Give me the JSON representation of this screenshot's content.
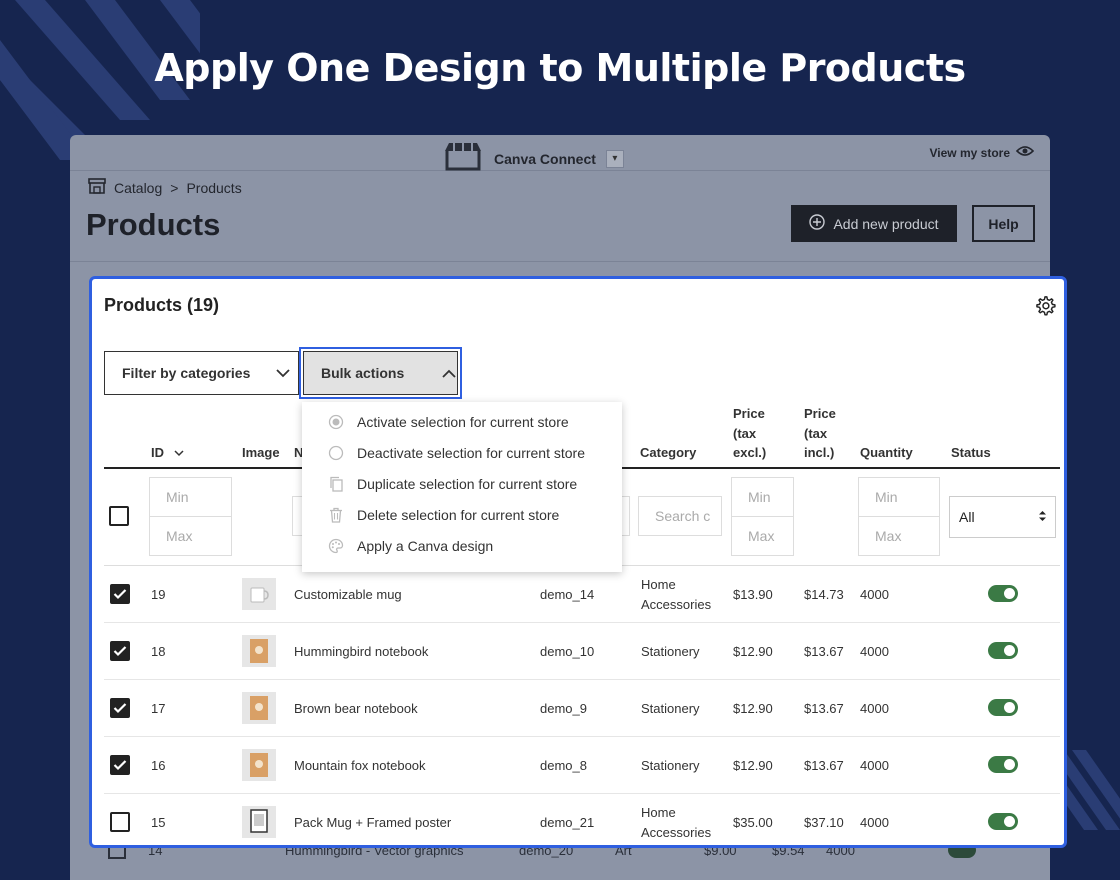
{
  "banner": {
    "title": "Apply One Design to Multiple Products"
  },
  "store": {
    "brand_name": "Canva Connect",
    "view_store": "View my store",
    "breadcrumb": [
      "Catalog",
      ">",
      "Products"
    ],
    "page_title": "Products",
    "add_product": "Add new product",
    "help": "Help",
    "ghost_row": {
      "id": "14",
      "name": "Hummingbird - Vector graphics",
      "reference": "demo_20",
      "category": "Art",
      "price_excl": "$9.00",
      "price_incl": "$9.54",
      "quantity": "4000"
    }
  },
  "card": {
    "title": "Products (19)",
    "filter_label": "Filter by categories",
    "bulk_label": "Bulk actions",
    "headers": {
      "id": "ID",
      "image": "Image",
      "name": "N",
      "category": "Category",
      "price_excl": [
        "Price",
        "(tax",
        "excl.)"
      ],
      "price_incl": [
        "Price",
        "(tax",
        "incl.)"
      ],
      "quantity": "Quantity",
      "status": "Status"
    },
    "filters": {
      "min": "Min",
      "max": "Max",
      "search": "Search c",
      "status_value": "All"
    },
    "bulk_menu": [
      {
        "label": "Activate selection for current store",
        "icon": "radio-filled-icon"
      },
      {
        "label": "Deactivate selection for current store",
        "icon": "radio-empty-icon"
      },
      {
        "label": "Duplicate selection for current store",
        "icon": "copy-icon"
      },
      {
        "label": "Delete selection for current store",
        "icon": "trash-icon"
      },
      {
        "label": "Apply a Canva design",
        "icon": "palette-icon"
      }
    ],
    "rows": [
      {
        "checked": true,
        "id": "19",
        "name": "Customizable mug",
        "reference": "demo_14",
        "category": [
          "Home",
          "Accessories"
        ],
        "price_excl": "$13.90",
        "price_incl": "$14.73",
        "quantity": "4000",
        "active": true
      },
      {
        "checked": true,
        "id": "18",
        "name": "Hummingbird notebook",
        "reference": "demo_10",
        "category": [
          "Stationery"
        ],
        "price_excl": "$12.90",
        "price_incl": "$13.67",
        "quantity": "4000",
        "active": true
      },
      {
        "checked": true,
        "id": "17",
        "name": "Brown bear notebook",
        "reference": "demo_9",
        "category": [
          "Stationery"
        ],
        "price_excl": "$12.90",
        "price_incl": "$13.67",
        "quantity": "4000",
        "active": true
      },
      {
        "checked": true,
        "id": "16",
        "name": "Mountain fox notebook",
        "reference": "demo_8",
        "category": [
          "Stationery"
        ],
        "price_excl": "$12.90",
        "price_incl": "$13.67",
        "quantity": "4000",
        "active": true
      },
      {
        "checked": false,
        "id": "15",
        "name": "Pack Mug + Framed poster",
        "reference": "demo_21",
        "category": [
          "Home",
          "Accessories"
        ],
        "price_excl": "$35.00",
        "price_incl": "$37.10",
        "quantity": "4000",
        "active": true
      }
    ]
  },
  "colors": {
    "background": "#16254f",
    "accent": "#2f5fe0",
    "toggle_on": "#3b7a45"
  }
}
